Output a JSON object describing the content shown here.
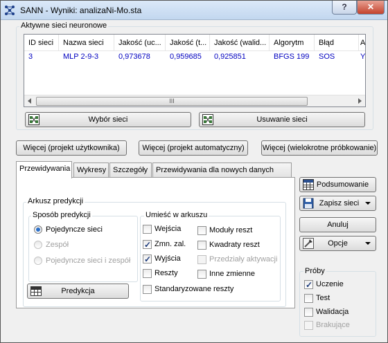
{
  "window": {
    "title": "SANN - Wyniki: analizaNi-Mo.sta",
    "help": "?",
    "close": "✕"
  },
  "networks_group": {
    "legend": "Aktywne sieci neuronowe",
    "columns": [
      "ID sieci",
      "Nazwa sieci",
      "Jakość (uc...",
      "Jakość (t...",
      "Jakość (walid...",
      "Algorytm",
      "Błąd",
      "A"
    ],
    "rows": [
      [
        "3",
        "MLP 2-9-3",
        "0,973678",
        "0,959685",
        "0,925851",
        "BFGS 199",
        "SOS",
        "Y"
      ]
    ],
    "scroll_grip": "III",
    "select_button": "Wybór sieci",
    "remove_button": "Usuwanie sieci"
  },
  "more_buttons": {
    "user": "Więcej (projekt użytkownika)",
    "auto": "Więcej (projekt automatyczny)",
    "multi": "Więcej (wielokrotne próbkowanie)"
  },
  "tabs": [
    "Przewidywania",
    "Wykresy",
    "Szczegóły",
    "Przewidywania dla nowych danych"
  ],
  "prediction": {
    "sheet_legend": "Arkusz predykcji",
    "method_legend": "Sposób predykcji",
    "methods": [
      {
        "label": "Pojedyncze sieci",
        "selected": true,
        "enabled": true
      },
      {
        "label": "Zespół",
        "selected": false,
        "enabled": false
      },
      {
        "label": "Pojedyncze sieci i zespół",
        "selected": false,
        "enabled": false
      }
    ],
    "place_legend": "Umieść w arkuszu",
    "place_left": [
      {
        "label": "Wejścia",
        "checked": false,
        "enabled": true
      },
      {
        "label": "Zmn. zal.",
        "checked": true,
        "enabled": true
      },
      {
        "label": "Wyjścia",
        "checked": true,
        "enabled": true
      },
      {
        "label": "Reszty",
        "checked": false,
        "enabled": true
      }
    ],
    "place_right": [
      {
        "label": "Moduły reszt",
        "checked": false,
        "enabled": true
      },
      {
        "label": "Kwadraty reszt",
        "checked": false,
        "enabled": true
      },
      {
        "label": "Przedziały aktywacji",
        "checked": false,
        "enabled": false
      },
      {
        "label": "Inne zmienne",
        "checked": false,
        "enabled": true
      }
    ],
    "standardized": {
      "label": "Standaryzowane reszty",
      "checked": false
    },
    "predict_button": "Predykcja"
  },
  "side": {
    "summary_button": "Podsumowanie",
    "save_button": "Zapisz sieci",
    "cancel_button": "Anuluj",
    "options_button": "Opcje"
  },
  "samples": {
    "legend": "Próby",
    "items": [
      {
        "label": "Uczenie",
        "checked": true,
        "enabled": true
      },
      {
        "label": "Test",
        "checked": false,
        "enabled": true
      },
      {
        "label": "Walidacja",
        "checked": false,
        "enabled": true
      },
      {
        "label": "Brakujące",
        "checked": false,
        "enabled": false
      }
    ]
  }
}
